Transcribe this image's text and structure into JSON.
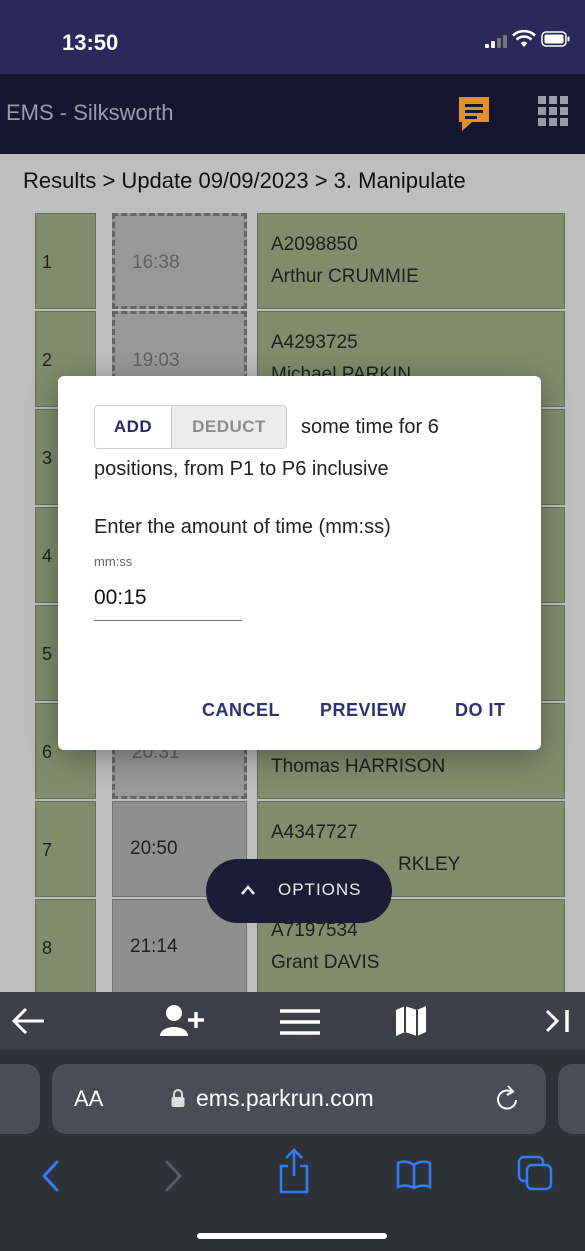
{
  "status_bar": {
    "time": "13:50"
  },
  "app_bar": {
    "title": "EMS - Silksworth"
  },
  "breadcrumb": "Results > Update 09/09/2023 > 3. Manipulate",
  "rows": [
    {
      "pos": "1",
      "time": "16:38",
      "id": "A2098850",
      "name": "Arthur CRUMMIE"
    },
    {
      "pos": "2",
      "time": "19:03",
      "id": "A4293725",
      "name": "Michael PARKIN"
    },
    {
      "pos": "3",
      "time": "",
      "id": "",
      "name": ""
    },
    {
      "pos": "4",
      "time": "",
      "id": "",
      "name": ""
    },
    {
      "pos": "5",
      "time": "",
      "id": "",
      "name": ""
    },
    {
      "pos": "6",
      "time": "20:31",
      "id": "",
      "name": "Thomas HARRISON"
    },
    {
      "pos": "7",
      "time": "20:50",
      "id": "A4347727",
      "name": "RKLEY"
    },
    {
      "pos": "8",
      "time": "21:14",
      "id": "A7197534",
      "name": "Grant DAVIS"
    }
  ],
  "dialog": {
    "add_label": "ADD",
    "deduct_label": "DEDUCT",
    "sentence_part1": "some time for 6",
    "sentence_part2": "positions, from P1 to P6 inclusive",
    "enter_label": "Enter the amount of time (mm:ss)",
    "field_label": "mm:ss",
    "field_value": "00:15",
    "cancel_label": "CANCEL",
    "preview_label": "PREVIEW",
    "doit_label": "DO IT"
  },
  "options_label": "OPTIONS",
  "safari": {
    "text_size_label": "AA",
    "url": "ems.parkrun.com"
  },
  "colors": {
    "status_bar_bg": "#2a2a5a",
    "app_bar_bg": "#161630",
    "accent_orange": "#f0a030",
    "dialog_button": "#2f3170",
    "safari_blue": "#2f7cf6"
  }
}
